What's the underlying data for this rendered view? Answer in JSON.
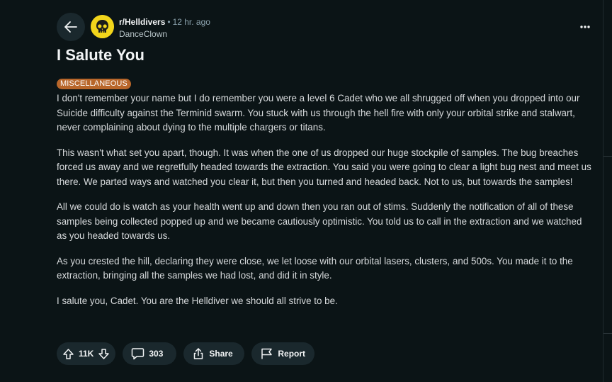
{
  "post": {
    "subreddit": "r/Helldivers",
    "separator": "•",
    "time": "12 hr. ago",
    "author": "DanceClown",
    "title": "I Salute You",
    "flair": "MISCELLANEOUS",
    "paragraphs": [
      "I don't remember your name but I do remember you were a level 6 Cadet who we all shrugged off when you dropped into our Suicide difficulty against the Terminid swarm. You stuck with us through the hell fire with only your orbital strike and stalwart, never complaining about dying to the multiple chargers or titans.",
      "This wasn't what set you apart, though. It was when the one of us dropped our huge stockpile of samples. The bug breaches forced us away and we regretfully headed towards the extraction. You said you were going to clear a light bug nest and meet us there. We parted ways and watched you clear it, but then you turned and headed back. Not to us, but towards the samples!",
      "All we could do is watch as your health went up and down then you ran out of stims. Suddenly the notification of all of these samples being collected popped up and we became cautiously optimistic. You told us to call in the extraction and we watched as you headed towards us.",
      "As you crested the hill, declaring they were close, we let loose with our orbital lasers, clusters, and 500s. You made it to the extraction, bringing all the samples we had lost, and did it in style.",
      "I salute you, Cadet. You are the Helldiver we should all strive to be."
    ]
  },
  "actions": {
    "vote_count": "11K",
    "comment_count": "303",
    "share_label": "Share",
    "report_label": "Report"
  },
  "icons": {
    "back": "arrow-left-icon",
    "avatar": "skull-icon",
    "more": "more-horizontal-icon",
    "upvote": "arrow-up-icon",
    "downvote": "arrow-down-icon",
    "comment": "comment-icon",
    "share": "share-icon",
    "report": "flag-icon"
  },
  "colors": {
    "background": "#0b1416",
    "pill": "#1a282d",
    "flair": "#b8662a",
    "avatar": "#f2d51b",
    "text": "#d7dadc"
  }
}
